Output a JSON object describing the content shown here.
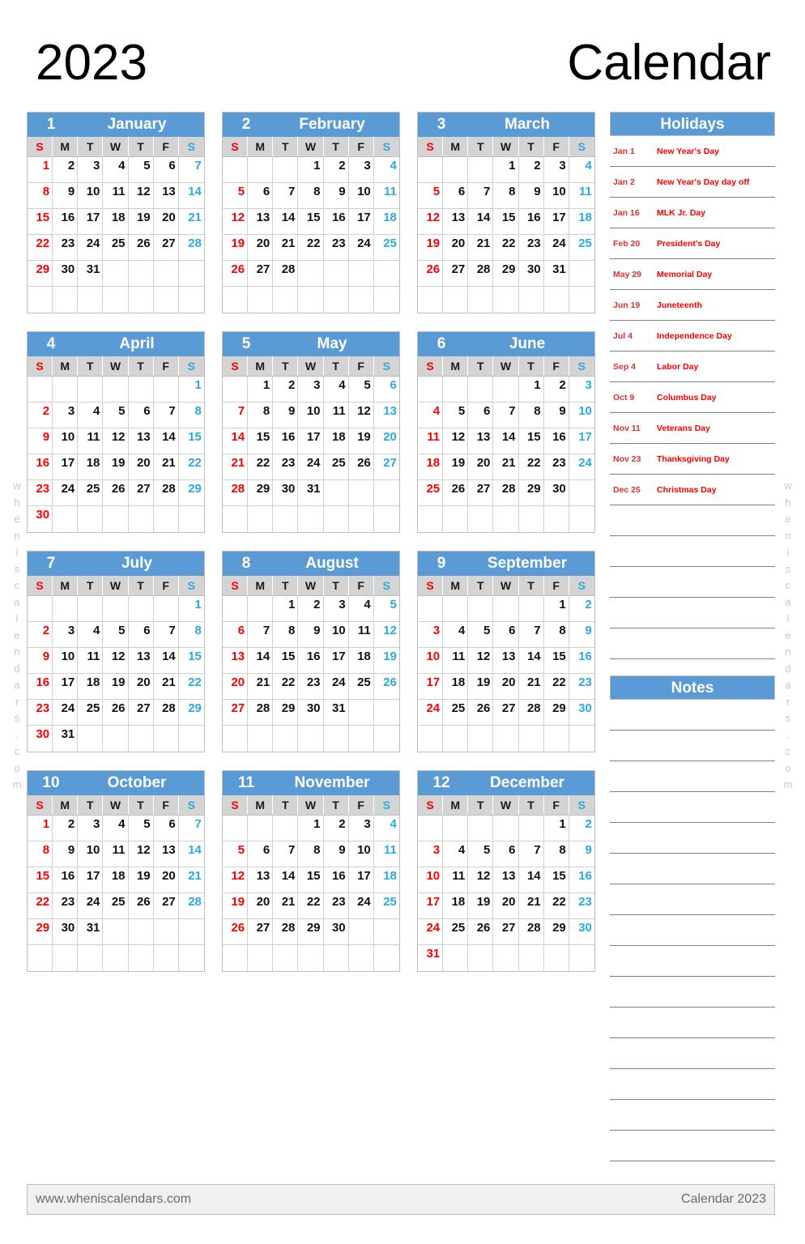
{
  "title": {
    "year": "2023",
    "word": "Calendar"
  },
  "colors": {
    "header_blue": "#5b9bd5",
    "dow_gray": "#d4d4d4",
    "sunday_red": "#ff0000",
    "saturday_blue": "#29abe2",
    "holiday_red": "#ff0000",
    "footer_bg": "#f0f0f0"
  },
  "weekday_labels": [
    "S",
    "M",
    "T",
    "W",
    "T",
    "F",
    "S"
  ],
  "months": [
    {
      "number": "1",
      "name": "January",
      "weeks": [
        [
          "1",
          "2",
          "3",
          "4",
          "5",
          "6",
          "7"
        ],
        [
          "8",
          "9",
          "10",
          "11",
          "12",
          "13",
          "14"
        ],
        [
          "15",
          "16",
          "17",
          "18",
          "19",
          "20",
          "21"
        ],
        [
          "22",
          "23",
          "24",
          "25",
          "26",
          "27",
          "28"
        ],
        [
          "29",
          "30",
          "31",
          "",
          "",
          "",
          ""
        ],
        [
          "",
          "",
          "",
          "",
          "",
          "",
          ""
        ]
      ]
    },
    {
      "number": "2",
      "name": "February",
      "weeks": [
        [
          "",
          "",
          "",
          "1",
          "2",
          "3",
          "4"
        ],
        [
          "5",
          "6",
          "7",
          "8",
          "9",
          "10",
          "11"
        ],
        [
          "12",
          "13",
          "14",
          "15",
          "16",
          "17",
          "18"
        ],
        [
          "19",
          "20",
          "21",
          "22",
          "23",
          "24",
          "25"
        ],
        [
          "26",
          "27",
          "28",
          "",
          "",
          "",
          ""
        ],
        [
          "",
          "",
          "",
          "",
          "",
          "",
          ""
        ]
      ]
    },
    {
      "number": "3",
      "name": "March",
      "weeks": [
        [
          "",
          "",
          "",
          "1",
          "2",
          "3",
          "4"
        ],
        [
          "5",
          "6",
          "7",
          "8",
          "9",
          "10",
          "11"
        ],
        [
          "12",
          "13",
          "14",
          "15",
          "16",
          "17",
          "18"
        ],
        [
          "19",
          "20",
          "21",
          "22",
          "23",
          "24",
          "25"
        ],
        [
          "26",
          "27",
          "28",
          "29",
          "30",
          "31",
          ""
        ],
        [
          "",
          "",
          "",
          "",
          "",
          "",
          ""
        ]
      ]
    },
    {
      "number": "4",
      "name": "April",
      "weeks": [
        [
          "",
          "",
          "",
          "",
          "",
          "",
          "1"
        ],
        [
          "2",
          "3",
          "4",
          "5",
          "6",
          "7",
          "8"
        ],
        [
          "9",
          "10",
          "11",
          "12",
          "13",
          "14",
          "15"
        ],
        [
          "16",
          "17",
          "18",
          "19",
          "20",
          "21",
          "22"
        ],
        [
          "23",
          "24",
          "25",
          "26",
          "27",
          "28",
          "29"
        ],
        [
          "30",
          "",
          "",
          "",
          "",
          "",
          ""
        ]
      ]
    },
    {
      "number": "5",
      "name": "May",
      "weeks": [
        [
          "",
          "1",
          "2",
          "3",
          "4",
          "5",
          "6"
        ],
        [
          "7",
          "8",
          "9",
          "10",
          "11",
          "12",
          "13"
        ],
        [
          "14",
          "15",
          "16",
          "17",
          "18",
          "19",
          "20"
        ],
        [
          "21",
          "22",
          "23",
          "24",
          "25",
          "26",
          "27"
        ],
        [
          "28",
          "29",
          "30",
          "31",
          "",
          "",
          ""
        ],
        [
          "",
          "",
          "",
          "",
          "",
          "",
          ""
        ]
      ]
    },
    {
      "number": "6",
      "name": "June",
      "weeks": [
        [
          "",
          "",
          "",
          "",
          "1",
          "2",
          "3"
        ],
        [
          "4",
          "5",
          "6",
          "7",
          "8",
          "9",
          "10"
        ],
        [
          "11",
          "12",
          "13",
          "14",
          "15",
          "16",
          "17"
        ],
        [
          "18",
          "19",
          "20",
          "21",
          "22",
          "23",
          "24"
        ],
        [
          "25",
          "26",
          "27",
          "28",
          "29",
          "30",
          ""
        ],
        [
          "",
          "",
          "",
          "",
          "",
          "",
          ""
        ]
      ]
    },
    {
      "number": "7",
      "name": "July",
      "weeks": [
        [
          "",
          "",
          "",
          "",
          "",
          "",
          "1"
        ],
        [
          "2",
          "3",
          "4",
          "5",
          "6",
          "7",
          "8"
        ],
        [
          "9",
          "10",
          "11",
          "12",
          "13",
          "14",
          "15"
        ],
        [
          "16",
          "17",
          "18",
          "19",
          "20",
          "21",
          "22"
        ],
        [
          "23",
          "24",
          "25",
          "26",
          "27",
          "28",
          "29"
        ],
        [
          "30",
          "31",
          "",
          "",
          "",
          "",
          ""
        ]
      ]
    },
    {
      "number": "8",
      "name": "August",
      "weeks": [
        [
          "",
          "",
          "1",
          "2",
          "3",
          "4",
          "5"
        ],
        [
          "6",
          "7",
          "8",
          "9",
          "10",
          "11",
          "12"
        ],
        [
          "13",
          "14",
          "15",
          "16",
          "17",
          "18",
          "19"
        ],
        [
          "20",
          "21",
          "22",
          "23",
          "24",
          "25",
          "26"
        ],
        [
          "27",
          "28",
          "29",
          "30",
          "31",
          "",
          ""
        ],
        [
          "",
          "",
          "",
          "",
          "",
          "",
          ""
        ]
      ]
    },
    {
      "number": "9",
      "name": "September",
      "weeks": [
        [
          "",
          "",
          "",
          "",
          "",
          "1",
          "2"
        ],
        [
          "3",
          "4",
          "5",
          "6",
          "7",
          "8",
          "9"
        ],
        [
          "10",
          "11",
          "12",
          "13",
          "14",
          "15",
          "16"
        ],
        [
          "17",
          "18",
          "19",
          "20",
          "21",
          "22",
          "23"
        ],
        [
          "24",
          "25",
          "26",
          "27",
          "28",
          "29",
          "30"
        ],
        [
          "",
          "",
          "",
          "",
          "",
          "",
          ""
        ]
      ]
    },
    {
      "number": "10",
      "name": "October",
      "weeks": [
        [
          "1",
          "2",
          "3",
          "4",
          "5",
          "6",
          "7"
        ],
        [
          "8",
          "9",
          "10",
          "11",
          "12",
          "13",
          "14"
        ],
        [
          "15",
          "16",
          "17",
          "18",
          "19",
          "20",
          "21"
        ],
        [
          "22",
          "23",
          "24",
          "25",
          "26",
          "27",
          "28"
        ],
        [
          "29",
          "30",
          "31",
          "",
          "",
          "",
          ""
        ],
        [
          "",
          "",
          "",
          "",
          "",
          "",
          ""
        ]
      ]
    },
    {
      "number": "11",
      "name": "November",
      "weeks": [
        [
          "",
          "",
          "",
          "1",
          "2",
          "3",
          "4"
        ],
        [
          "5",
          "6",
          "7",
          "8",
          "9",
          "10",
          "11"
        ],
        [
          "12",
          "13",
          "14",
          "15",
          "16",
          "17",
          "18"
        ],
        [
          "19",
          "20",
          "21",
          "22",
          "23",
          "24",
          "25"
        ],
        [
          "26",
          "27",
          "28",
          "29",
          "30",
          "",
          ""
        ],
        [
          "",
          "",
          "",
          "",
          "",
          "",
          ""
        ]
      ]
    },
    {
      "number": "12",
      "name": "December",
      "weeks": [
        [
          "",
          "",
          "",
          "",
          "",
          "1",
          "2"
        ],
        [
          "3",
          "4",
          "5",
          "6",
          "7",
          "8",
          "9"
        ],
        [
          "10",
          "11",
          "12",
          "13",
          "14",
          "15",
          "16"
        ],
        [
          "17",
          "18",
          "19",
          "20",
          "21",
          "22",
          "23"
        ],
        [
          "24",
          "25",
          "26",
          "27",
          "28",
          "29",
          "30"
        ],
        [
          "31",
          "",
          "",
          "",
          "",
          "",
          ""
        ]
      ]
    }
  ],
  "holidays_panel": {
    "title": "Holidays",
    "items": [
      {
        "date": "Jan 1",
        "name": "New Year's Day"
      },
      {
        "date": "Jan 2",
        "name": "New Year's Day day off"
      },
      {
        "date": "Jan 16",
        "name": "MLK Jr. Day"
      },
      {
        "date": "Feb 20",
        "name": "President's Day"
      },
      {
        "date": "May 29",
        "name": "Memorial Day"
      },
      {
        "date": "Jun 19",
        "name": "Juneteenth"
      },
      {
        "date": "Jul 4",
        "name": "Independence Day"
      },
      {
        "date": "Sep 4",
        "name": "Labor Day"
      },
      {
        "date": "Oct 9",
        "name": "Columbus Day"
      },
      {
        "date": "Nov 11",
        "name": "Veterans Day"
      },
      {
        "date": "Nov 23",
        "name": "Thanksgiving Day"
      },
      {
        "date": "Dec 25",
        "name": "Christmas Day"
      }
    ],
    "blank_lines": 5
  },
  "notes_panel": {
    "title": "Notes",
    "blank_lines": 15
  },
  "footer": {
    "left": "www.wheniscalendars.com",
    "right": "Calendar 2023"
  },
  "watermark": {
    "text": "wheniscalendars.com"
  }
}
